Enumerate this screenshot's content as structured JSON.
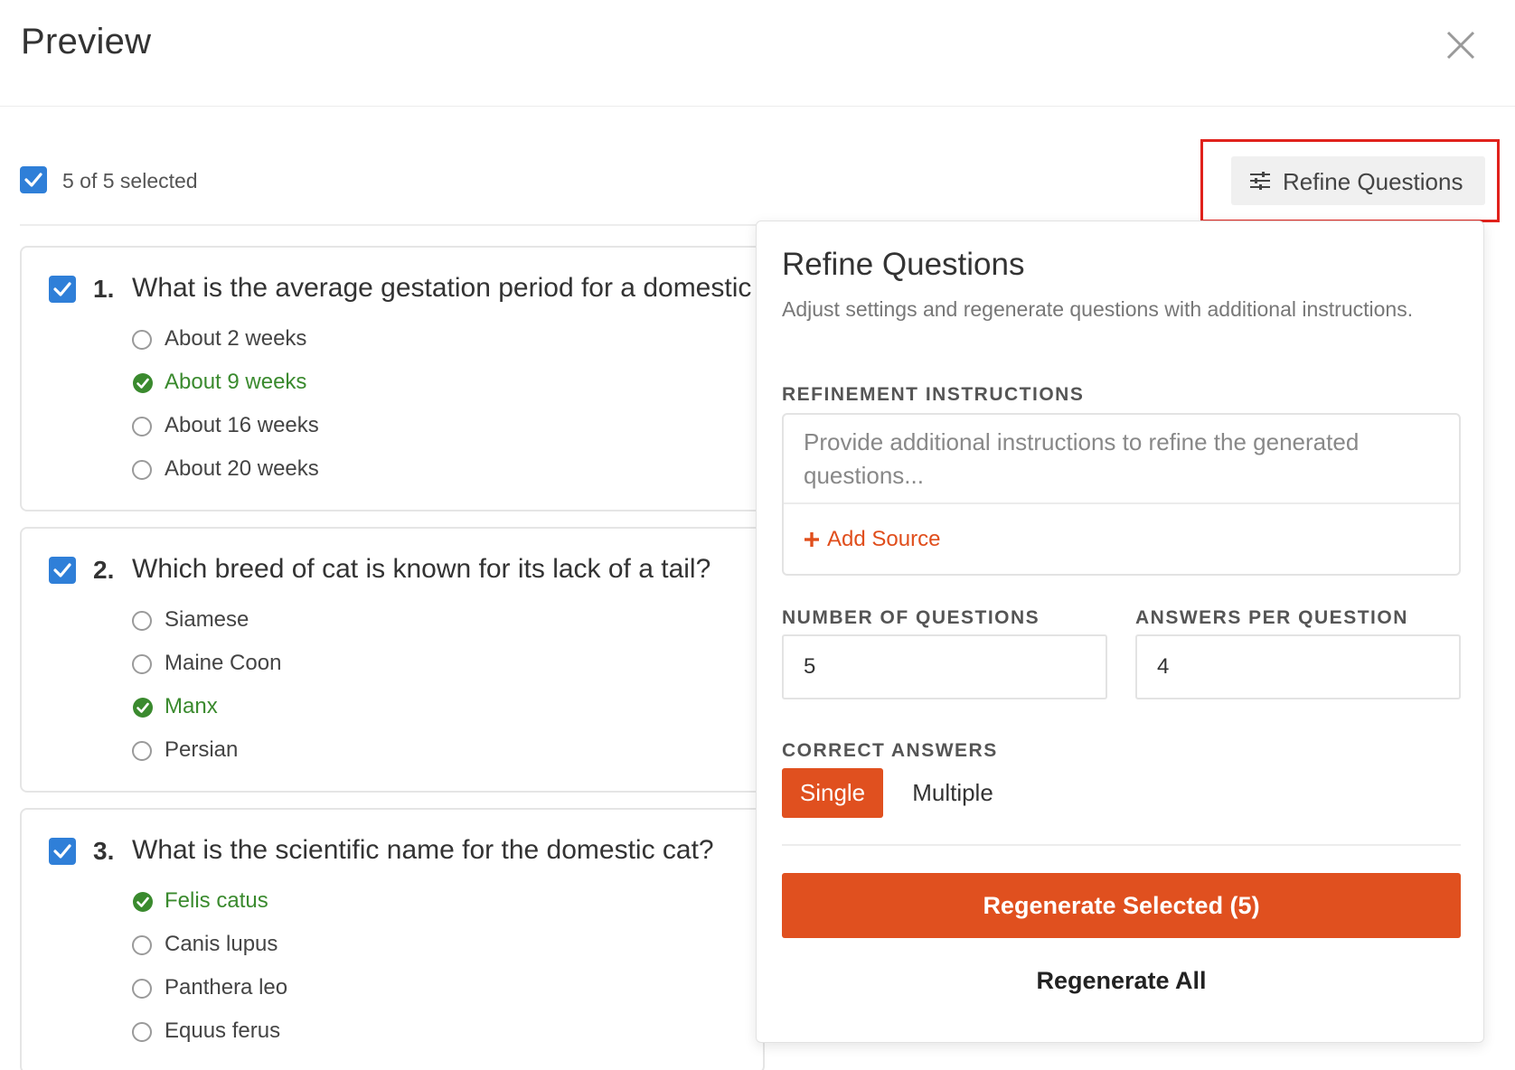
{
  "header": {
    "title": "Preview",
    "close_icon": "close-icon"
  },
  "selection": {
    "label": "5 of 5 selected",
    "checked": true
  },
  "toolbar": {
    "refine_label": "Refine Questions",
    "refine_icon": "tune-icon"
  },
  "questions": [
    {
      "number": "1.",
      "text": "What is the average gestation period for a domestic cat?",
      "options": [
        {
          "label": "About 2 weeks",
          "correct": false
        },
        {
          "label": "About 9 weeks",
          "correct": true
        },
        {
          "label": "About 16 weeks",
          "correct": false
        },
        {
          "label": "About 20 weeks",
          "correct": false
        }
      ]
    },
    {
      "number": "2.",
      "text": "Which breed of cat is known for its lack of a tail?",
      "options": [
        {
          "label": "Siamese",
          "correct": false
        },
        {
          "label": "Maine Coon",
          "correct": false
        },
        {
          "label": "Manx",
          "correct": true
        },
        {
          "label": "Persian",
          "correct": false
        }
      ]
    },
    {
      "number": "3.",
      "text": "What is the scientific name for the domestic cat?",
      "options": [
        {
          "label": "Felis catus",
          "correct": true
        },
        {
          "label": "Canis lupus",
          "correct": false
        },
        {
          "label": "Panthera leo",
          "correct": false
        },
        {
          "label": "Equus ferus",
          "correct": false
        }
      ]
    }
  ],
  "panel": {
    "title": "Refine Questions",
    "description": "Adjust settings and regenerate questions with additional instructions.",
    "instructions_label": "REFINEMENT INSTRUCTIONS",
    "instructions_placeholder": "Provide additional instructions to refine the generated questions...",
    "add_source_label": "Add Source",
    "num_questions_label": "NUMBER OF QUESTIONS",
    "num_questions_value": "5",
    "answers_label": "ANSWERS PER QUESTION",
    "answers_value": "4",
    "correct_answers_label": "CORRECT ANSWERS",
    "single_label": "Single",
    "multiple_label": "Multiple",
    "selected_mode": "Single",
    "regenerate_selected_label": "Regenerate Selected (5)",
    "regenerate_all_label": "Regenerate All"
  },
  "colors": {
    "accent": "#e0501f",
    "checkbox": "#2f7fd8",
    "correct": "#3a8a2e",
    "highlight": "#e0221c"
  }
}
